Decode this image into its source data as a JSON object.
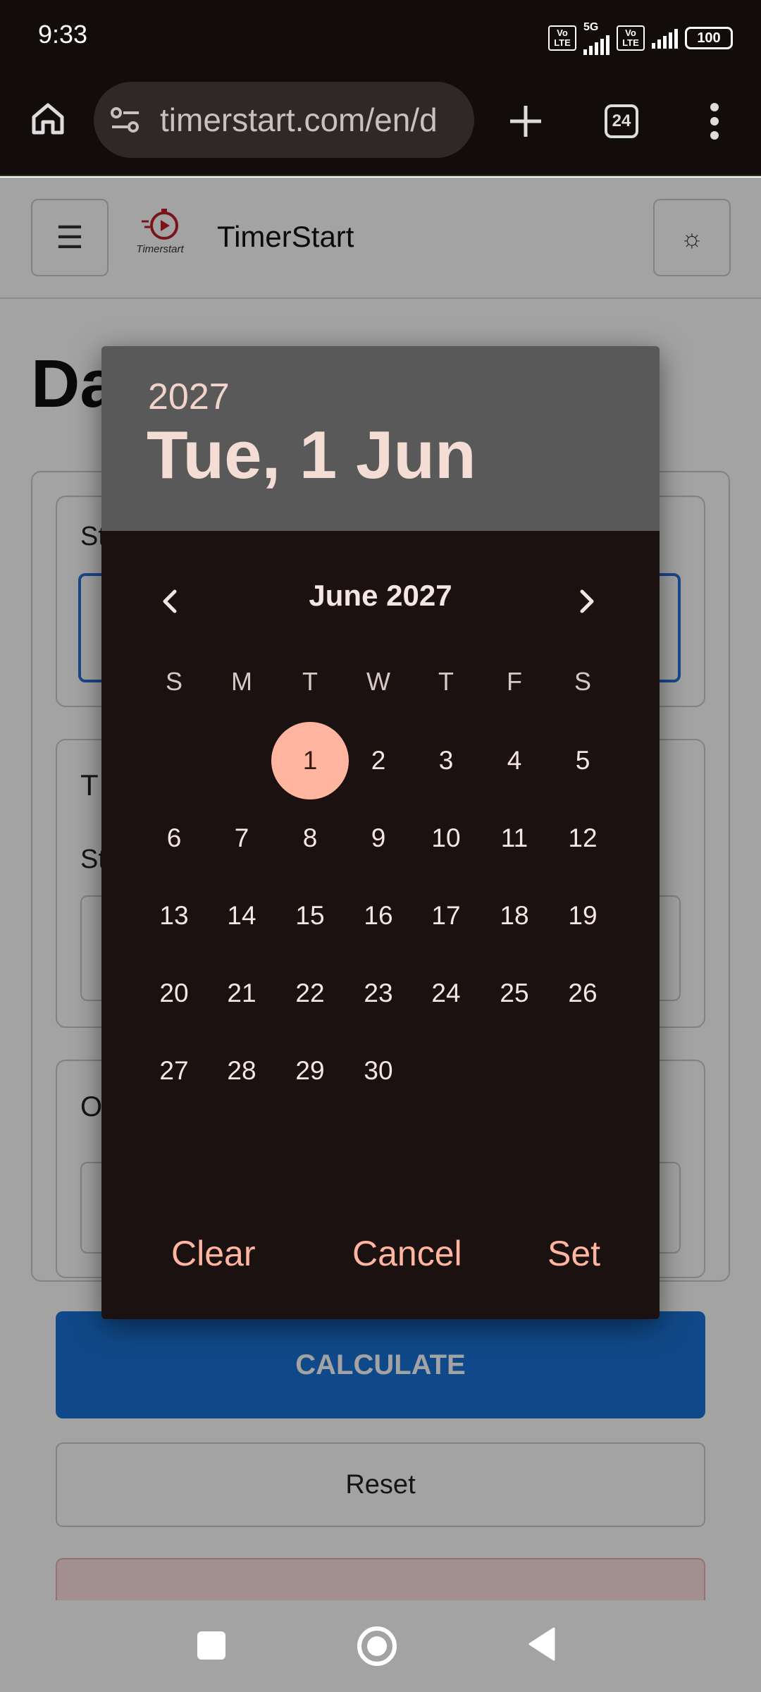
{
  "status_bar": {
    "time": "9:33",
    "network": "5G",
    "volte_1": "Vo LTE",
    "volte_2": "Vo LTE",
    "battery": "100"
  },
  "browser": {
    "url": "timerstart.com/en/d",
    "tab_count": "24"
  },
  "site": {
    "name": "TimerStart",
    "logo_text": "Timerstart",
    "page_title_partial": "Da",
    "theme_icon": "☼",
    "menu_icon": "☰"
  },
  "form": {
    "label_start_partial": "St",
    "label_t_partial": "T",
    "label_start2_partial": "St",
    "label_o_partial": "O",
    "calculate_label": "CALCULATE",
    "reset_label": "Reset"
  },
  "date_picker": {
    "year": "2027",
    "selected_date_label": "Tue, 1 Jun",
    "month_label": "June 2027",
    "weekdays": [
      "S",
      "M",
      "T",
      "W",
      "T",
      "F",
      "S"
    ],
    "first_weekday_index": 2,
    "days_in_month": 30,
    "selected_day": 1,
    "clear_label": "Clear",
    "cancel_label": "Cancel",
    "set_label": "Set",
    "accent_color": "#ffb59f"
  }
}
